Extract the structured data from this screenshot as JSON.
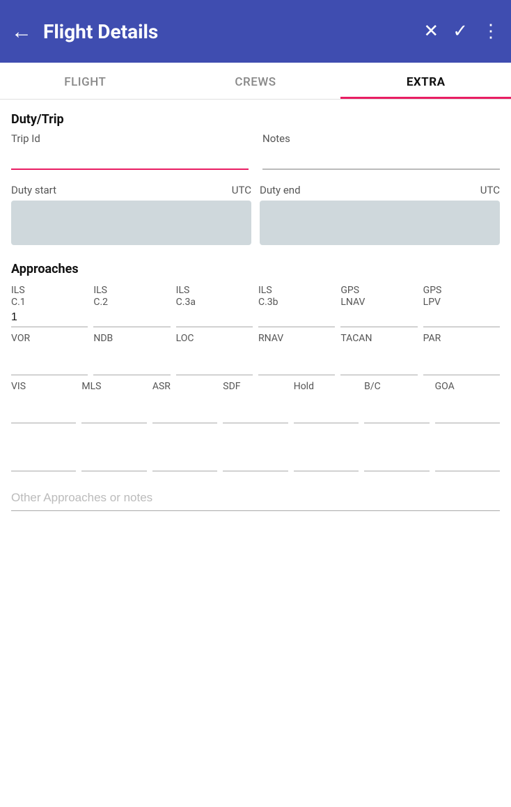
{
  "header": {
    "title": "Flight Details",
    "back_icon": "←",
    "close_icon": "✕",
    "check_icon": "✓",
    "more_icon": "⋮"
  },
  "tabs": [
    {
      "id": "flight",
      "label": "FLIGHT",
      "active": false
    },
    {
      "id": "crews",
      "label": "CREWS",
      "active": false
    },
    {
      "id": "extra",
      "label": "EXTRA",
      "active": true
    }
  ],
  "extra": {
    "section_title": "Duty/Trip",
    "trip_id_label": "Trip Id",
    "notes_label": "Notes",
    "trip_id_value": "",
    "notes_value": "",
    "duty_start_label": "Duty start",
    "duty_start_utc": "UTC",
    "duty_end_label": "Duty end",
    "duty_end_utc": "UTC",
    "approaches_title": "Approaches",
    "approach_cols_row1": [
      {
        "label": "ILS\nC.1",
        "value": "1"
      },
      {
        "label": "ILS\nC.2",
        "value": ""
      },
      {
        "label": "ILS\nC.3a",
        "value": ""
      },
      {
        "label": "ILS\nC.3b",
        "value": ""
      },
      {
        "label": "GPS\nLNAV",
        "value": ""
      },
      {
        "label": "GPS\nLPV",
        "value": ""
      }
    ],
    "approach_cols_row2": [
      {
        "label": "VOR",
        "value": ""
      },
      {
        "label": "NDB",
        "value": ""
      },
      {
        "label": "LOC",
        "value": ""
      },
      {
        "label": "RNAV",
        "value": ""
      },
      {
        "label": "TACAN",
        "value": ""
      },
      {
        "label": "PAR",
        "value": ""
      }
    ],
    "approach_cols_row3": [
      {
        "label": "VIS",
        "value": ""
      },
      {
        "label": "MLS",
        "value": ""
      },
      {
        "label": "ASR",
        "value": ""
      },
      {
        "label": "SDF",
        "value": ""
      },
      {
        "label": "Hold",
        "value": ""
      },
      {
        "label": "B/C",
        "value": ""
      },
      {
        "label": "GOA",
        "value": ""
      }
    ],
    "approach_cols_row4": [
      "",
      "",
      "",
      "",
      "",
      "",
      ""
    ],
    "other_approaches_placeholder": "Other Approaches or notes"
  }
}
